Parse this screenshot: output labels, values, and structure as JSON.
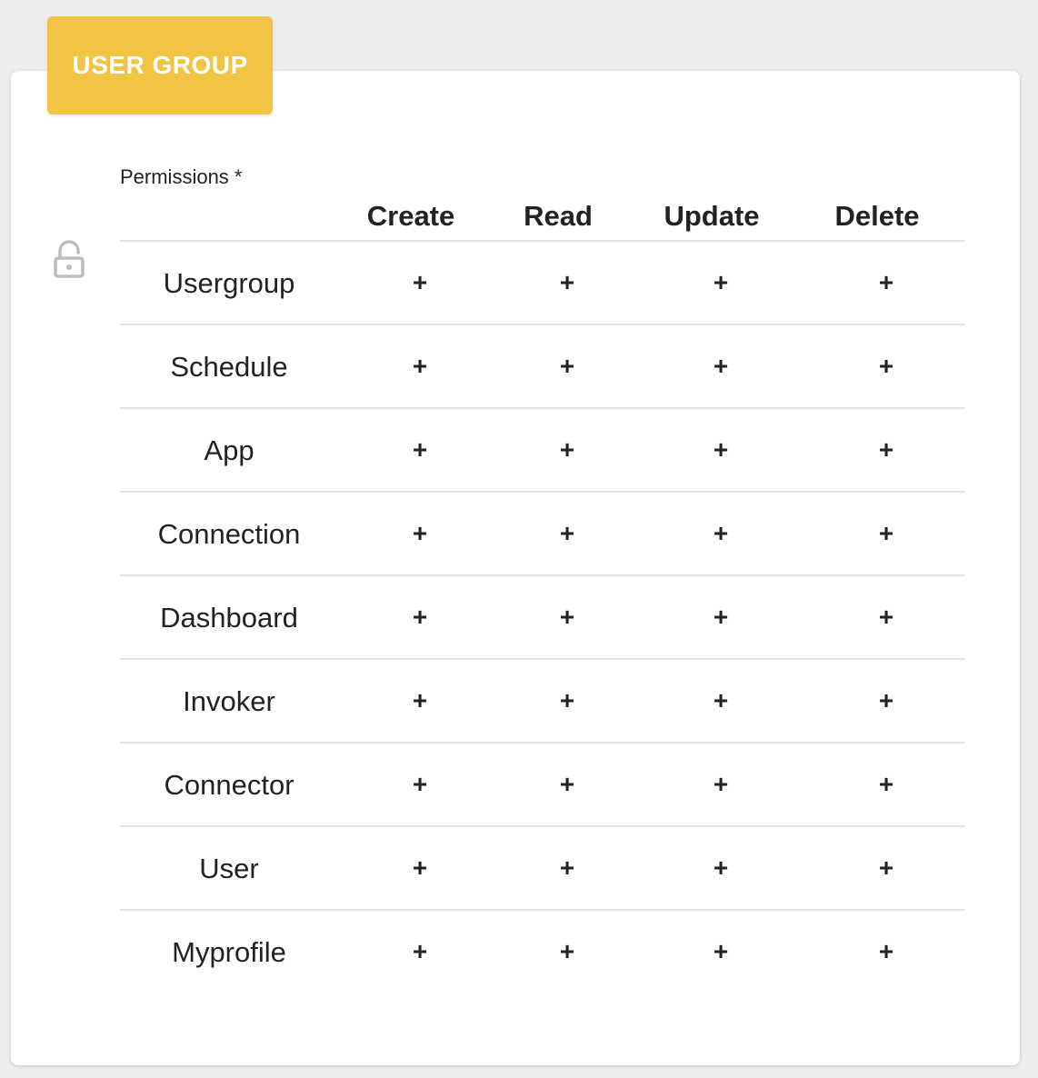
{
  "header": {
    "title": "USER GROUP"
  },
  "permissions": {
    "label": "Permissions *",
    "columns": [
      "Create",
      "Read",
      "Update",
      "Delete"
    ],
    "rows": [
      {
        "label": "Usergroup",
        "cells": [
          "+",
          "+",
          "+",
          "+"
        ]
      },
      {
        "label": "Schedule",
        "cells": [
          "+",
          "+",
          "+",
          "+"
        ]
      },
      {
        "label": "App",
        "cells": [
          "+",
          "+",
          "+",
          "+"
        ]
      },
      {
        "label": "Connection",
        "cells": [
          "+",
          "+",
          "+",
          "+"
        ]
      },
      {
        "label": "Dashboard",
        "cells": [
          "+",
          "+",
          "+",
          "+"
        ]
      },
      {
        "label": "Invoker",
        "cells": [
          "+",
          "+",
          "+",
          "+"
        ]
      },
      {
        "label": "Connector",
        "cells": [
          "+",
          "+",
          "+",
          "+"
        ]
      },
      {
        "label": "User",
        "cells": [
          "+",
          "+",
          "+",
          "+"
        ]
      },
      {
        "label": "Myprofile",
        "cells": [
          "+",
          "+",
          "+",
          "+"
        ]
      }
    ]
  },
  "icons": {
    "lock": "unlocked-padlock-icon"
  },
  "colors": {
    "accent": "#f2c444",
    "background": "#eeeeee",
    "card": "#ffffff",
    "divider": "#e3e3e3",
    "icon": "#bdbdbd"
  }
}
